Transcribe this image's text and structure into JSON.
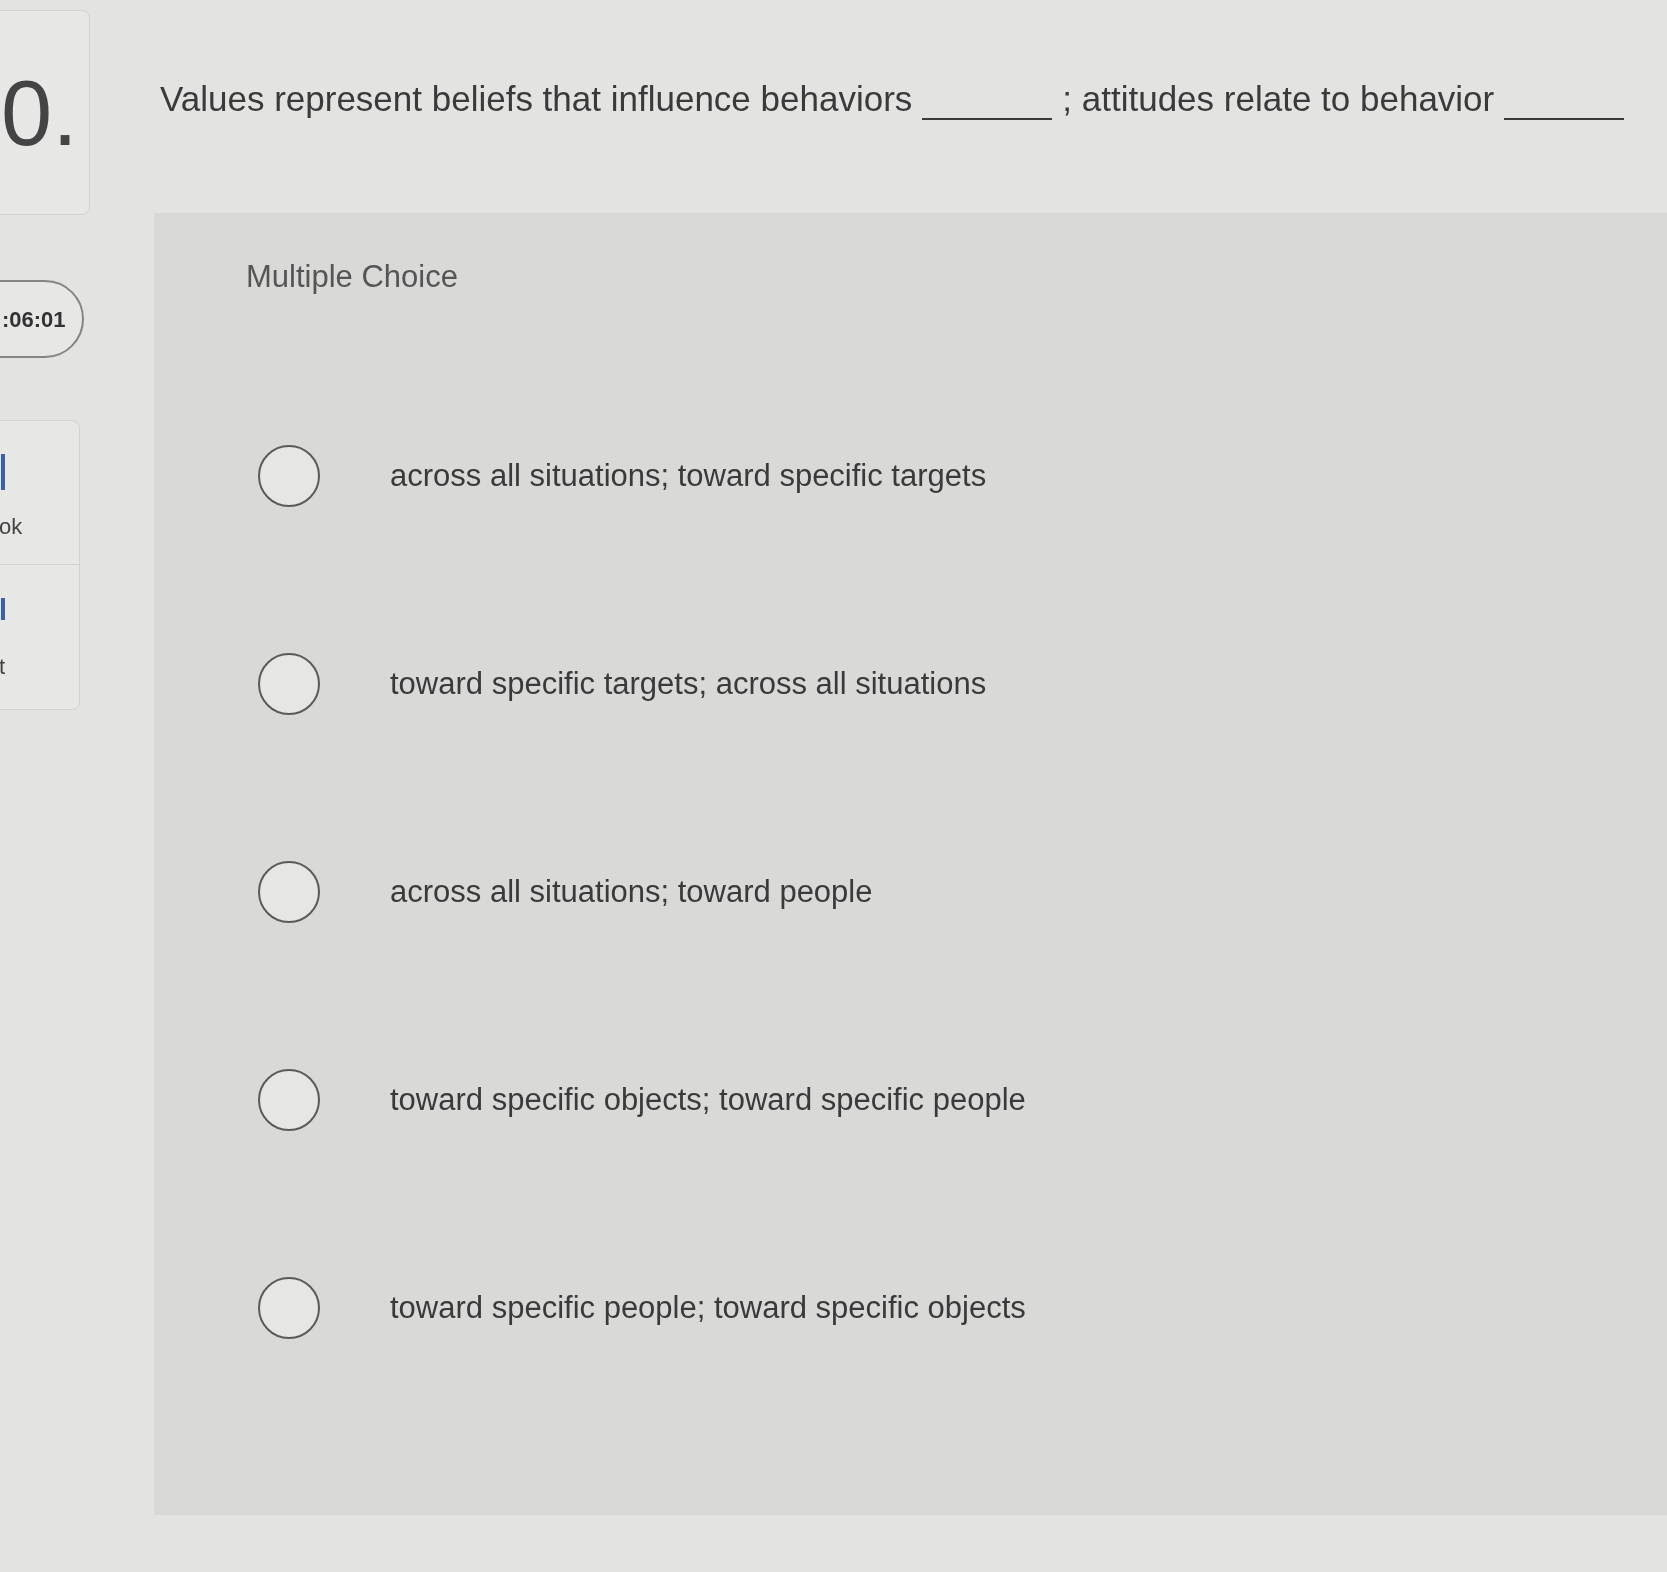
{
  "sidebar": {
    "question_number": "0.",
    "timer": ":06:01",
    "tools": [
      {
        "label": "ok"
      },
      {
        "label": "t"
      }
    ]
  },
  "question": {
    "parts": [
      {
        "kind": "text",
        "text": "Values represent beliefs that influence behaviors"
      },
      {
        "kind": "blank"
      },
      {
        "kind": "text",
        "text": "; attitudes relate to behavior"
      },
      {
        "kind": "blank"
      }
    ]
  },
  "answer_panel": {
    "heading": "Multiple Choice",
    "choices": [
      {
        "label": "across all situations; toward specific targets",
        "selected": false
      },
      {
        "label": "toward specific targets; across all situations",
        "selected": false
      },
      {
        "label": "across all situations; toward people",
        "selected": false
      },
      {
        "label": "toward specific objects; toward specific people",
        "selected": false
      },
      {
        "label": "toward specific people; toward specific objects",
        "selected": false
      }
    ]
  }
}
